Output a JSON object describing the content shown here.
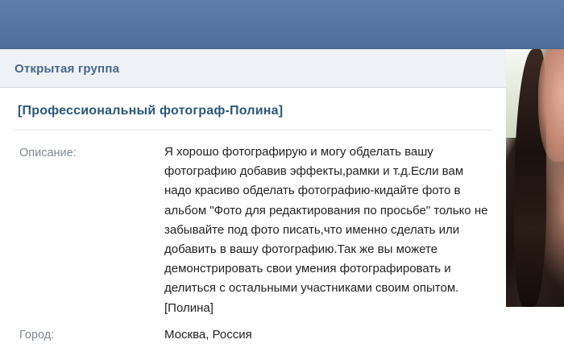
{
  "group": {
    "type_label": "Открытая группа",
    "title": "[Профессиональный фотограф-Полина]"
  },
  "info": {
    "description_label": "Описание:",
    "description_text": "Я хорошо фотографирую и могу обделать вашу фотографию добавив эффекты,рамки и т.д.Если вам надо красиво обделать фотографию-кидайте фото в альбом \"Фото для редактирования по просьбе\" только не забывайте под фото писать,что именно сделать или добавить в вашу фотографию.Так же вы можете демонстрировать свои умения фотографировать и делиться с остальными участниками своим опытом. [Полина]",
    "city_label": "Город:",
    "city_value": "Москва, Россия"
  },
  "colors": {
    "topbar": "#5c7ea8",
    "link": "#2b587a",
    "header_text": "#45688e",
    "label_text": "#7f8a96"
  },
  "icons": {
    "group_photo": "group-avatar-image"
  }
}
